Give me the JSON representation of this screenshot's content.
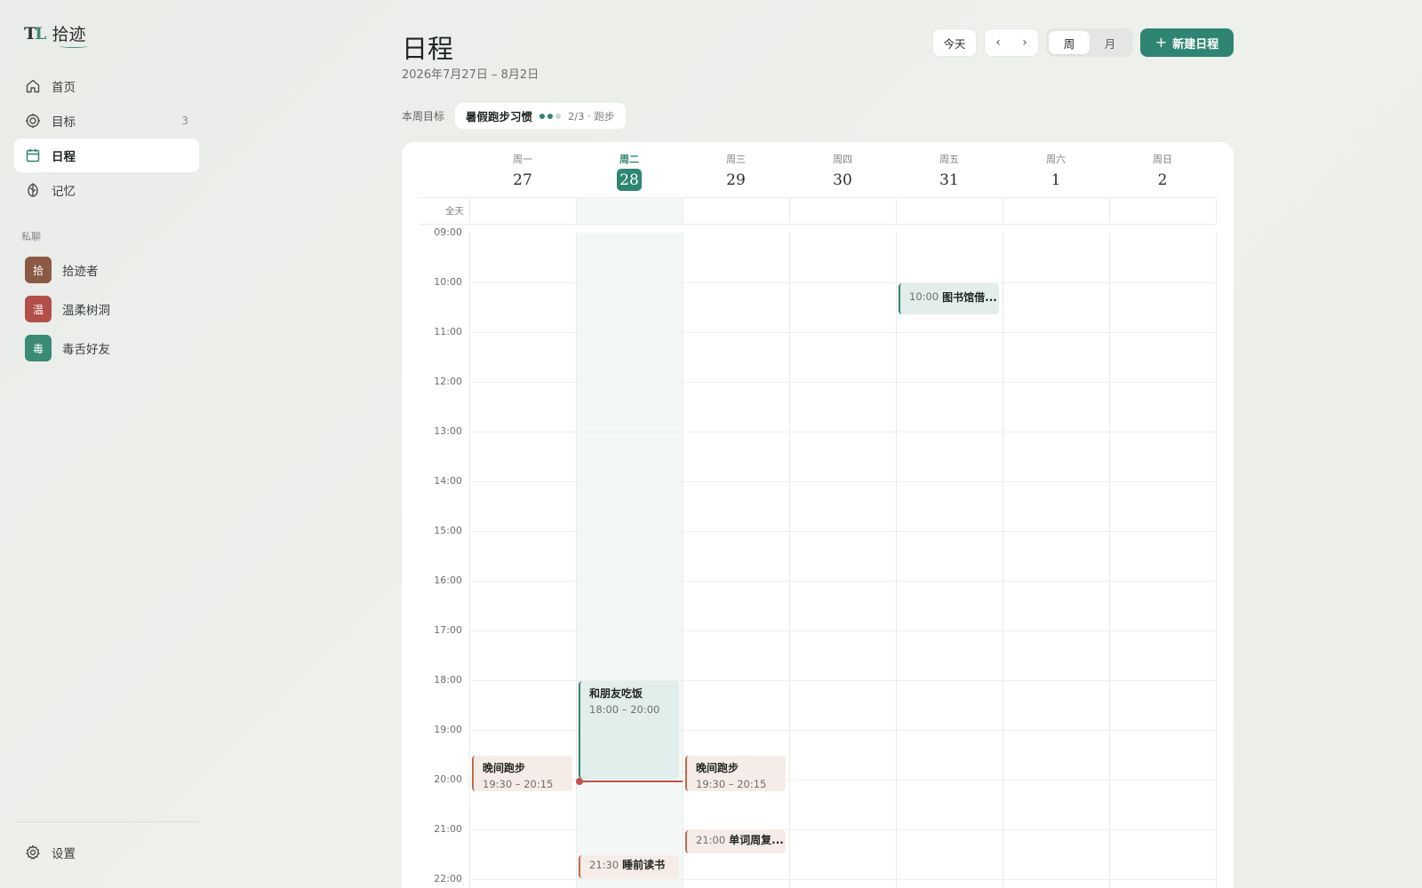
{
  "brand": {
    "mark_t": "T",
    "mark_l": "L",
    "name": "拾迹"
  },
  "nav": [
    {
      "label": "首页",
      "icon": "home-icon"
    },
    {
      "label": "目标",
      "icon": "target-icon",
      "count": "3"
    },
    {
      "label": "日程",
      "icon": "calendar-icon",
      "active": true
    },
    {
      "label": "记忆",
      "icon": "memory-icon"
    }
  ],
  "private_chat": {
    "label": "私聊",
    "items": [
      {
        "avatar": "拾",
        "name": "拾迹者",
        "color": "#8a5a45"
      },
      {
        "avatar": "温",
        "name": "温柔树洞",
        "color": "#b34f4a"
      },
      {
        "avatar": "毒",
        "name": "毒舌好友",
        "color": "#3a8a76"
      }
    ]
  },
  "settings_label": "设置",
  "header": {
    "title": "日程",
    "date_range": "2026年7月27日 – 8月2日",
    "today_button": "今天",
    "prev": "‹",
    "next": "›",
    "view_week": "周",
    "view_month": "月",
    "new_button": "新建日程",
    "new_icon": "+"
  },
  "goals": {
    "label": "本周目标",
    "items": [
      {
        "name": "暑假跑步习惯",
        "done": 2,
        "total": 3,
        "meta": "2/3 · 跑步"
      }
    ]
  },
  "calendar": {
    "allday_label": "全天",
    "days": [
      {
        "weekday": "周一",
        "date": "27"
      },
      {
        "weekday": "周二",
        "date": "28",
        "today": true
      },
      {
        "weekday": "周三",
        "date": "29"
      },
      {
        "weekday": "周四",
        "date": "30"
      },
      {
        "weekday": "周五",
        "date": "31"
      },
      {
        "weekday": "周六",
        "date": "1"
      },
      {
        "weekday": "周日",
        "date": "2"
      }
    ],
    "hours": [
      "09:00",
      "10:00",
      "11:00",
      "12:00",
      "13:00",
      "14:00",
      "15:00",
      "16:00",
      "17:00",
      "18:00",
      "19:00",
      "20:00",
      "21:00",
      "22:00"
    ],
    "now_time": "20:02",
    "events": [
      {
        "day": 4,
        "start": "10:00",
        "end": "10:40",
        "title": "图书馆借...",
        "time_text": "10:00",
        "color": "green",
        "inline": true
      },
      {
        "day": 1,
        "start": "18:00",
        "end": "20:00",
        "title": "和朋友吃饭",
        "time_text": "18:00 – 20:00",
        "color": "green"
      },
      {
        "day": 0,
        "start": "19:30",
        "end": "20:15",
        "title": "晚间跑步",
        "time_text": "19:30 – 20:15",
        "color": "orange"
      },
      {
        "day": 2,
        "start": "19:30",
        "end": "20:15",
        "title": "晚间跑步",
        "time_text": "19:30 – 20:15",
        "color": "orange"
      },
      {
        "day": 2,
        "start": "21:00",
        "end": "21:30",
        "title": "单词周复...",
        "time_text": "21:00",
        "color": "orange",
        "inline": true
      },
      {
        "day": 1,
        "start": "21:30",
        "end": "22:00",
        "title": "睡前读书",
        "time_text": "21:30",
        "color": "orange",
        "inline": true
      }
    ]
  }
}
